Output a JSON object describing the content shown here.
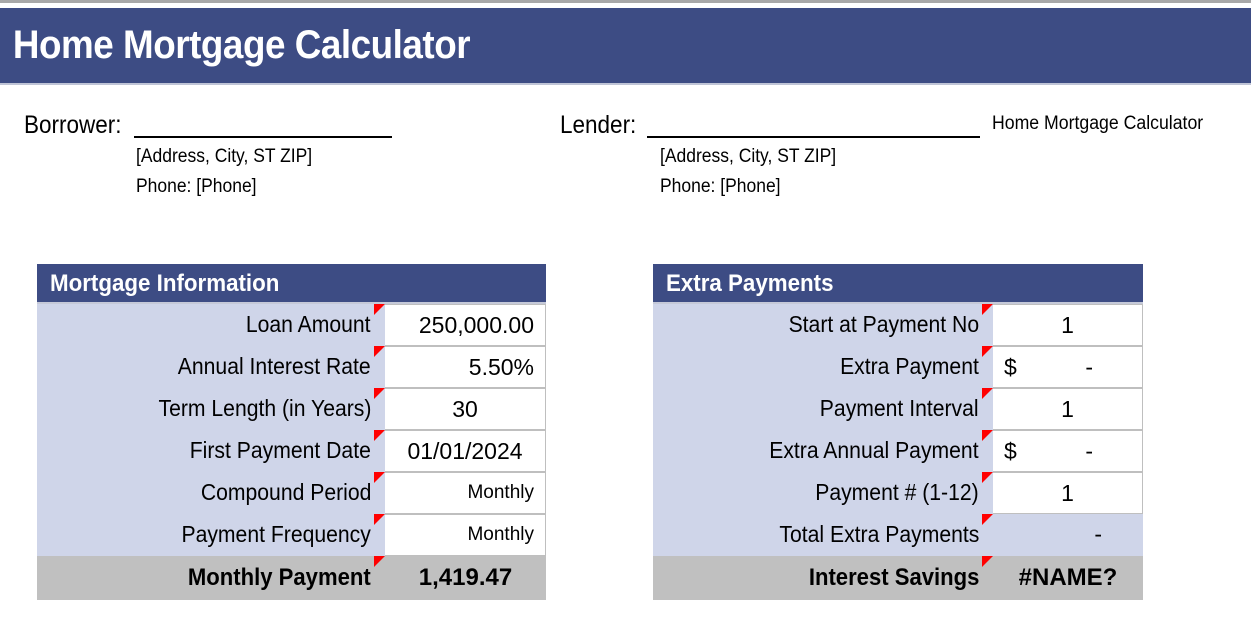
{
  "banner": {
    "title": "Home Mortgage Calculator"
  },
  "document_name": "Home Mortgage Calculator",
  "parties": {
    "borrower": {
      "label": "Borrower:",
      "name_value": "",
      "name_placeholder": "",
      "address": "[Address, City, ST ZIP]",
      "phone": "Phone: [Phone]"
    },
    "lender": {
      "label": "Lender:",
      "name_value": "",
      "name_placeholder": "",
      "address": "[Address, City, ST ZIP]",
      "phone": "Phone: [Phone]"
    }
  },
  "mortgage_information": {
    "title": "Mortgage Information",
    "rows": [
      {
        "label": "Loan Amount",
        "value": "250,000.00",
        "align": "align-right",
        "size": "",
        "marker": "red"
      },
      {
        "label": "Annual Interest Rate",
        "value": "5.50%",
        "align": "align-right",
        "size": "",
        "marker": "red"
      },
      {
        "label": "Term Length (in Years)",
        "value": "30",
        "align": "align-center",
        "size": "",
        "marker": "red"
      },
      {
        "label": "First Payment Date",
        "value": "01/01/2024",
        "align": "align-center",
        "size": "",
        "marker": "red"
      },
      {
        "label": "Compound Period",
        "value": "Monthly",
        "align": "align-right",
        "size": "small",
        "marker": "red"
      },
      {
        "label": "Payment Frequency",
        "value": "Monthly",
        "align": "align-right",
        "size": "small",
        "marker": "red"
      }
    ],
    "total": {
      "label": "Monthly Payment",
      "value": "1,419.47",
      "marker": "red"
    }
  },
  "extra_payments": {
    "title": "Extra Payments",
    "rows": [
      {
        "label": "Start at Payment No",
        "value": "1",
        "prefix": "",
        "align": "align-center",
        "style": "normal",
        "marker": "red"
      },
      {
        "label": "Extra Payment",
        "value": "-",
        "prefix": "$",
        "align": "currency",
        "style": "normal",
        "marker": "red"
      },
      {
        "label": "Payment Interval",
        "value": "1",
        "prefix": "",
        "align": "align-center",
        "style": "normal",
        "marker": "red"
      },
      {
        "label": "Extra Annual Payment",
        "value": "-",
        "prefix": "$",
        "align": "currency",
        "style": "normal",
        "marker": "red"
      },
      {
        "label": "Payment # (1-12)",
        "value": "1",
        "prefix": "",
        "align": "align-center",
        "style": "normal",
        "marker": "red"
      },
      {
        "label": "Total Extra Payments",
        "value": "-",
        "prefix": "",
        "align": "align-right",
        "style": "plain",
        "marker": "red"
      }
    ],
    "total": {
      "label": "Interest Savings",
      "value": "#NAME?",
      "marker": "red-green"
    }
  },
  "colors": {
    "banner_blue": "#3d4c84",
    "label_fill": "#cfd5e9",
    "total_fill": "#c0c0c0",
    "comment_red": "#ff0000",
    "comment_green": "#00a000",
    "cell_border": "#bfbfbf"
  }
}
